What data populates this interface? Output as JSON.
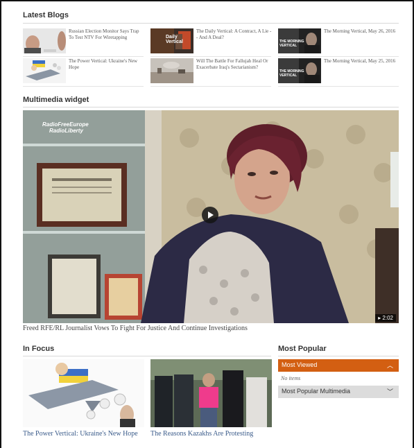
{
  "latest_blogs": {
    "heading": "Latest Blogs",
    "items": [
      {
        "title": "Russian Election Monitor Says Trap To Test NTV For Wiretapping"
      },
      {
        "title": "The Daily Vertical: A Contract, A Lie -- And A Deal?"
      },
      {
        "title": "The Morning Vertical, May 26, 2016"
      },
      {
        "title": "The Power Vertical: Ukraine's New Hope"
      },
      {
        "title": "Will The Battle For Fallujah Heal Or Exacerbate Iraq's Sectarianism?"
      },
      {
        "title": "The Morning Vertical, May 25, 2016"
      }
    ],
    "thumb_labels": {
      "daily": "Daily",
      "vertical": "Vertical",
      "morning": "THE MORNING",
      "vertical2": "VERTICAL"
    }
  },
  "multimedia": {
    "heading": "Multimedia widget",
    "logo_line1": "RadioFreeEurope",
    "logo_line2": "RadioLiberty",
    "duration": "▸ 2:02",
    "caption": "Freed RFE/RL Journalist Vows To Fight For Justice And Continue Investigations"
  },
  "in_focus": {
    "heading": "In Focus",
    "items": [
      {
        "title": "The Power Vertical: Ukraine's New Hope"
      },
      {
        "title": "The Reasons Kazakhs Are Protesting"
      }
    ]
  },
  "most_popular": {
    "heading": "Most Popular",
    "tabs": [
      {
        "label": "Most Viewed",
        "state": "expanded",
        "body": "No items"
      },
      {
        "label": "Most Popular Multimedia",
        "state": "collapsed"
      }
    ]
  },
  "colors": {
    "accent_orange": "#d35f12",
    "grey_tab": "#dcdcdc",
    "link_blue": "#3a5b8a"
  }
}
